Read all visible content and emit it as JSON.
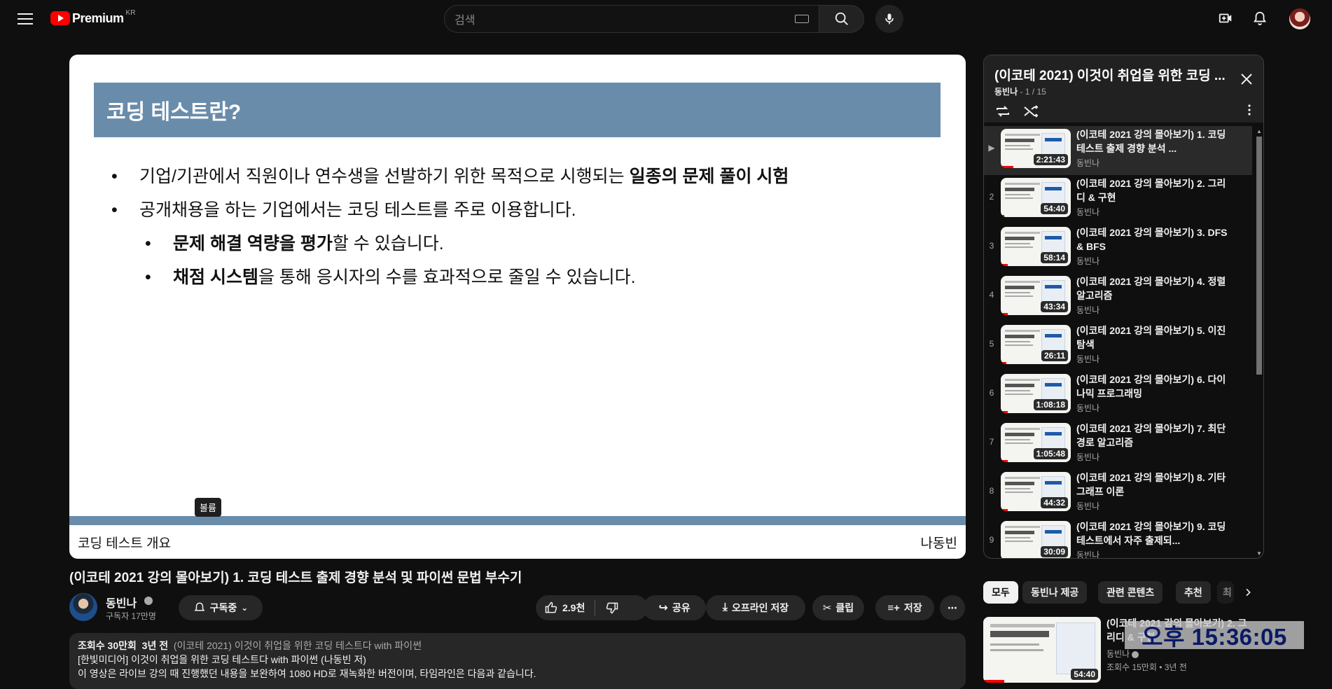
{
  "header": {
    "logo_text": "Premium",
    "country_code": "KR",
    "search_placeholder": "검색"
  },
  "player": {
    "slide_title": "코딩 테스트란?",
    "bullets": [
      {
        "pre": "기업/기관에서 직원이나 연수생을 선발하기 위한 목적으로 시행되는 ",
        "bold": "일종의 문제 풀이 시험",
        "post": ""
      },
      {
        "pre": "공개채용을 하는 기업에서는 코딩 테스트를 주로 이용합니다.",
        "bold": "",
        "post": ""
      },
      {
        "pre": "",
        "bold": "문제 해결 역량을 평가",
        "post": "할 수 있습니다."
      },
      {
        "pre": "",
        "bold": "채점 시스템",
        "post": "을 통해 응시자의 수를 효과적으로 줄일 수 있습니다."
      }
    ],
    "footer_left": "코딩 테스트 개요",
    "footer_right": "나동빈",
    "volume_tooltip": "볼륨",
    "progress": 0.0
  },
  "video": {
    "title": "(이코테 2021 강의 몰아보기) 1. 코딩 테스트 출제 경향 분석 및 파이썬 문법 부수기",
    "channel": "동빈나",
    "subscribers": "구독자 17만명",
    "subscribe_label": "구독중",
    "likes": "2.9천",
    "share_label": "공유",
    "offline_label": "오프라인 저장",
    "clip_label": "클립",
    "save_label": "저장"
  },
  "description": {
    "views": "조회수 30만회",
    "age": "3년 전",
    "playlist_ref": "(이코테 2021) 이것이 취업을 위한 코딩 테스트다 with 파이썬",
    "line2": "[한빛미디어] 이것이 취업을 위한 코딩 테스트다 with 파이썬 (나동빈 저)",
    "line3": "이 영상은 라이브 강의 때 진행했던 내용을 보완하여 1080 HD로 재녹화한 버전이며, 타임라인은 다음과 같습니다."
  },
  "playlist": {
    "title": "(이코테 2021) 이것이 취업을 위한 코딩 ...",
    "owner": "동빈나",
    "position": "1 / 15",
    "items": [
      {
        "index": "▶",
        "title": "(이코테 2021 강의 몰아보기) 1. 코딩 테스트 출제 경향 분석 ...",
        "channel": "동빈나",
        "duration": "2:21:43",
        "watched": 0.18
      },
      {
        "index": "2",
        "title": "(이코테 2021 강의 몰아보기) 2. 그리디 & 구현",
        "channel": "동빈나",
        "duration": "54:40",
        "watched": 0.05
      },
      {
        "index": "3",
        "title": "(이코테 2021 강의 몰아보기) 3. DFS & BFS",
        "channel": "동빈나",
        "duration": "58:14",
        "watched": 0.1
      },
      {
        "index": "4",
        "title": "(이코테 2021 강의 몰아보기) 4. 정렬 알고리즘",
        "channel": "동빈나",
        "duration": "43:34",
        "watched": 0.1
      },
      {
        "index": "5",
        "title": "(이코테 2021 강의 몰아보기) 5. 이진 탐색",
        "channel": "동빈나",
        "duration": "26:11",
        "watched": 0.08
      },
      {
        "index": "6",
        "title": "(이코테 2021 강의 몰아보기) 6. 다이나믹 프로그래밍",
        "channel": "동빈나",
        "duration": "1:08:18",
        "watched": 0.1
      },
      {
        "index": "7",
        "title": "(이코테 2021 강의 몰아보기) 7. 최단 경로 알고리즘",
        "channel": "동빈나",
        "duration": "1:05:48",
        "watched": 0.1
      },
      {
        "index": "8",
        "title": "(이코테 2021 강의 몰아보기) 8. 기타 그래프 이론",
        "channel": "동빈나",
        "duration": "44:32",
        "watched": 0.1
      },
      {
        "index": "9",
        "title": "(이코테 2021 강의 몰아보기) 9. 코딩 테스트에서 자주 출제되...",
        "channel": "동빈나",
        "duration": "30:09",
        "watched": 0.1
      }
    ]
  },
  "chips": [
    "모두",
    "동빈나 제공",
    "관련 콘텐츠",
    "추천",
    "최"
  ],
  "recommendation": {
    "title": "(이코테 2021 강의 몰아보기) 2. 그리디 & 구현",
    "channel": "동빈나",
    "meta": "조회수 15만회 • 3년 전",
    "duration": "54:40"
  },
  "overlay_clock": "오후 15:36:05",
  "colors": {
    "accent_red": "#ff0000",
    "slide_blue": "#6a8cab",
    "bg": "#0f0f0f"
  }
}
